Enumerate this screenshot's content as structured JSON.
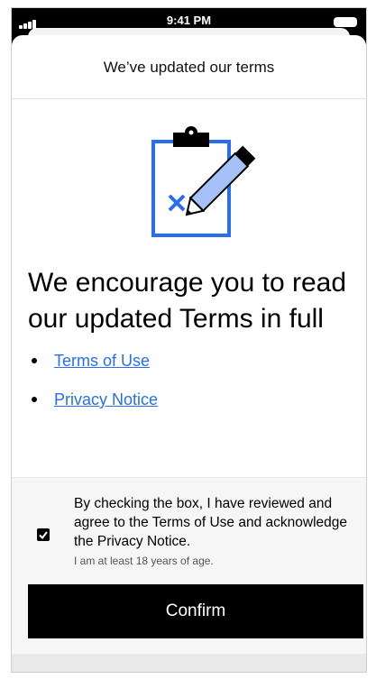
{
  "status_bar": {
    "time": "9:41 PM"
  },
  "sheet": {
    "title": "We’ve updated our terms"
  },
  "illustration": {
    "icon": "clipboard-pencil-icon",
    "colors": {
      "blue": "#276ef1",
      "light_blue": "#a6c1f7",
      "black": "#000000"
    }
  },
  "main": {
    "headline": "We encourage you to read our updated Terms in full",
    "links": [
      {
        "label": "Terms of Use"
      },
      {
        "label": "Privacy Notice"
      }
    ]
  },
  "consent": {
    "checked": true,
    "text": "By checking the box, I have reviewed and agree to the Terms of Use and acknowledge the Privacy Notice.",
    "age_text": "I am at least 18 years of age."
  },
  "confirm": {
    "label": "Confirm"
  },
  "colors": {
    "link": "#276ef1",
    "button_bg": "#000000",
    "button_text": "#ffffff"
  }
}
